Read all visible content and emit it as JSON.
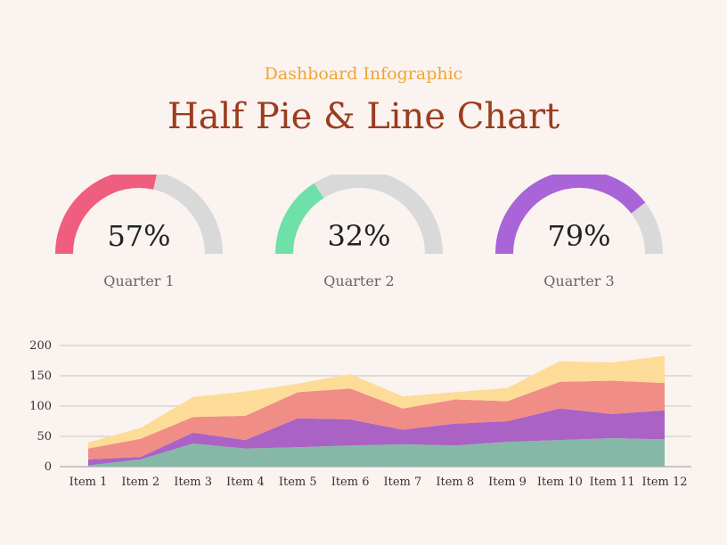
{
  "header": {
    "subtitle": "Dashboard Infographic",
    "title": "Half Pie & Line Chart"
  },
  "colors": {
    "track": "#d9d9d9",
    "teal": "#86b8a8",
    "purple": "#aa62c4",
    "salmon": "#f08d86",
    "yellow": "#fddc97",
    "q1": "#ef5d7f",
    "q2": "#6ee0a8",
    "q3": "#a964d8"
  },
  "gauges": [
    {
      "percent_label": "57%",
      "value": 57,
      "label": "Quarter 1",
      "color": "#ef5d7f"
    },
    {
      "percent_label": "32%",
      "value": 32,
      "label": "Quarter 2",
      "color": "#6ee0a8"
    },
    {
      "percent_label": "79%",
      "value": 79,
      "label": "Quarter 3",
      "color": "#a964d8"
    }
  ],
  "chart_data": {
    "type": "area",
    "stacked": true,
    "categories": [
      "Item 1",
      "Item 2",
      "Item 3",
      "Item 4",
      "Item 5",
      "Item 6",
      "Item 7",
      "Item 8",
      "Item 9",
      "Item 10",
      "Item 11",
      "Item 12"
    ],
    "series": [
      {
        "values": [
          2,
          12,
          38,
          30,
          32,
          35,
          37,
          35,
          41,
          44,
          47,
          45
        ],
        "color": "#86b8a8"
      },
      {
        "values": [
          10,
          4,
          18,
          14,
          48,
          43,
          24,
          36,
          34,
          52,
          40,
          48
        ],
        "color": "#aa62c4"
      },
      {
        "values": [
          18,
          30,
          26,
          40,
          43,
          51,
          35,
          40,
          33,
          44,
          55,
          45
        ],
        "color": "#f08d86"
      },
      {
        "values": [
          10,
          18,
          33,
          40,
          14,
          24,
          20,
          12,
          22,
          34,
          30,
          45
        ],
        "color": "#fddc97"
      }
    ],
    "yticks": [
      0,
      50,
      100,
      150,
      200
    ],
    "ylim": [
      0,
      200
    ],
    "grid": true
  }
}
